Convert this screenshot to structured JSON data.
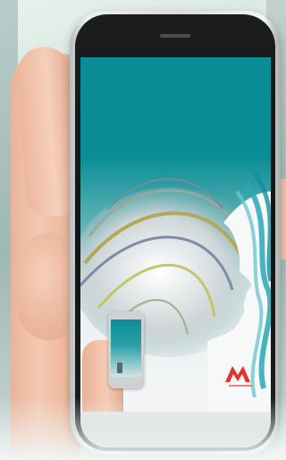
{
  "scene": {
    "subject": "",
    "colors": {
      "screen_teal": "#0a8d96",
      "skin": "#f3c9b2",
      "phone_bezel": "#121315",
      "logo_red": "#e2332f"
    }
  },
  "icons": {
    "logo": "brand-logo-icon"
  }
}
